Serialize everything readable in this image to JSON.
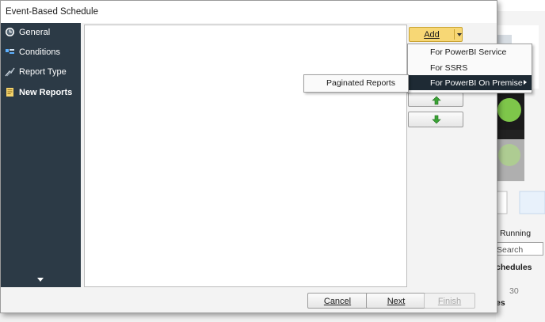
{
  "dialog": {
    "title": "Event-Based Schedule"
  },
  "sidebar": {
    "items": [
      {
        "label": "General",
        "icon": "clock-icon",
        "active": false
      },
      {
        "label": "Conditions",
        "icon": "conditions-icon",
        "active": false
      },
      {
        "label": "Report Type",
        "icon": "report-type-icon",
        "active": false
      },
      {
        "label": "New Reports",
        "icon": "document-icon",
        "active": true
      }
    ]
  },
  "add_button": {
    "label": "Add"
  },
  "add_menu": {
    "items": [
      {
        "label": "For PowerBI Service"
      },
      {
        "label": "For SSRS"
      },
      {
        "label": "For PowerBI On Premise"
      }
    ]
  },
  "submenu": {
    "items": [
      {
        "label": "Paginated Reports"
      }
    ]
  },
  "footer": {
    "cancel": "Cancel",
    "next": "Next",
    "finish": "Finish"
  },
  "background_app": {
    "running_label": "Running",
    "search_placeholder": "Search",
    "schedules_label": "chedules",
    "number": "30",
    "truncated_label": "es"
  },
  "colors": {
    "sidebar": "#2c3a46",
    "menu_highlight": "#1e2a34",
    "add_button": "#f7d775",
    "arrow_green": "#3aa335"
  }
}
